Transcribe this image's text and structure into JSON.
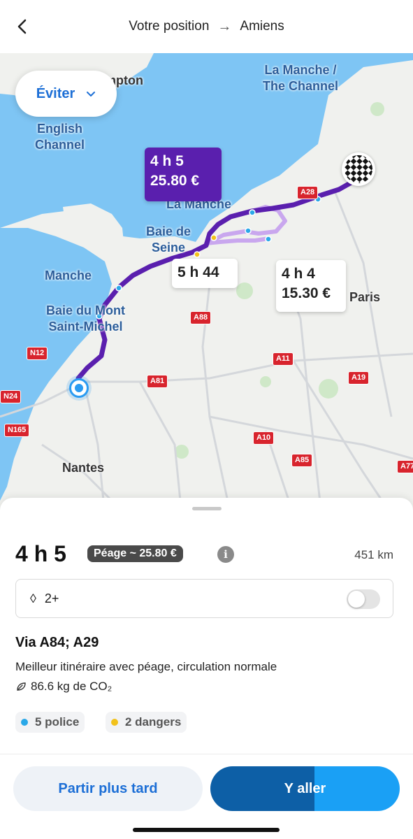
{
  "header": {
    "origin": "Votre position",
    "destination": "Amiens"
  },
  "map": {
    "avoid_label": "Éviter",
    "labels": {
      "english_channel": "English\nChannel",
      "la_manche_the_channel": "La Manche /\nThe Channel",
      "la_manche": "La Manche",
      "baie_de_seine": "Baie de\nSeine",
      "manche": "Manche",
      "baie_mont": "Baie du Mont\nSaint-Michel",
      "nantes": "Nantes",
      "paris": "Paris",
      "hampton": "mpton"
    },
    "roads": [
      "A28",
      "A88",
      "A11",
      "A19",
      "A81",
      "A10",
      "A85",
      "A77",
      "N12",
      "N24",
      "N165"
    ],
    "routes": {
      "selected": {
        "time": "4 h 5",
        "price": "25.80 €"
      },
      "alt1": {
        "time": "5 h 44"
      },
      "alt2": {
        "time": "4 h 4",
        "price": "15.30 €"
      }
    }
  },
  "sheet": {
    "duration": "4 h 5",
    "toll": "Péage ~ 25.80 €",
    "distance": "451 km",
    "carpool_label": "2+",
    "via": "Via A84; A29",
    "description": "Meilleur itinéraire avec péage, circulation normale",
    "co2": "86.6 kg de CO₂",
    "chips": {
      "police": "5 police",
      "dangers": "2 dangers"
    },
    "buttons": {
      "later": "Partir plus tard",
      "go": "Y aller"
    }
  },
  "colors": {
    "accent_blue": "#1d6fd6",
    "route_purple": "#5a1fae",
    "police": "#2aa8e8",
    "danger": "#f2c21b"
  }
}
